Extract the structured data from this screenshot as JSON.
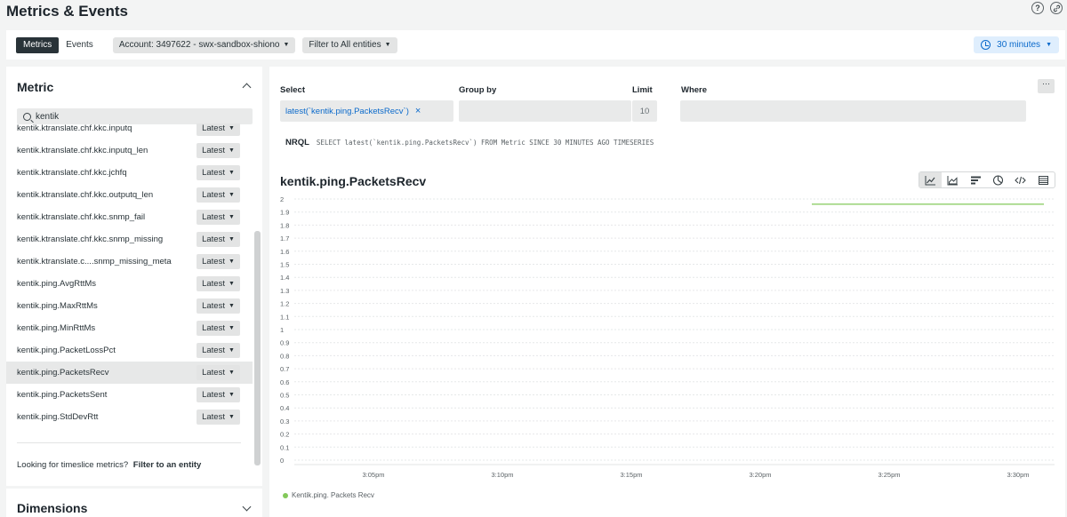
{
  "page": {
    "title": "Metrics & Events",
    "help_icon": "question-circle-icon",
    "link_icon": "link-icon"
  },
  "toolbar": {
    "tabs": [
      {
        "label": "Metrics",
        "active": true
      },
      {
        "label": "Events",
        "active": false
      }
    ],
    "account_label": "Account: 3497622 - swx-sandbox-shiono",
    "filter_label": "Filter to All entities",
    "time_label": "30 minutes"
  },
  "left_panel": {
    "title": "Metric",
    "search_value": "kentik",
    "metrics": [
      {
        "name": "kentik.ktranslate.chf.kkc.inputq",
        "agg": "Latest"
      },
      {
        "name": "kentik.ktranslate.chf.kkc.inputq_len",
        "agg": "Latest"
      },
      {
        "name": "kentik.ktranslate.chf.kkc.jchfq",
        "agg": "Latest"
      },
      {
        "name": "kentik.ktranslate.chf.kkc.outputq_len",
        "agg": "Latest"
      },
      {
        "name": "kentik.ktranslate.chf.kkc.snmp_fail",
        "agg": "Latest"
      },
      {
        "name": "kentik.ktranslate.chf.kkc.snmp_missing",
        "agg": "Latest"
      },
      {
        "name": "kentik.ktranslate.c....snmp_missing_meta",
        "agg": "Latest"
      },
      {
        "name": "kentik.ping.AvgRttMs",
        "agg": "Latest"
      },
      {
        "name": "kentik.ping.MaxRttMs",
        "agg": "Latest"
      },
      {
        "name": "kentik.ping.MinRttMs",
        "agg": "Latest"
      },
      {
        "name": "kentik.ping.PacketLossPct",
        "agg": "Latest"
      },
      {
        "name": "kentik.ping.PacketsRecv",
        "agg": "Latest",
        "selected": true
      },
      {
        "name": "kentik.ping.PacketsSent",
        "agg": "Latest"
      },
      {
        "name": "kentik.ping.StdDevRtt",
        "agg": "Latest"
      }
    ],
    "timeslice_text": "Looking for timeslice metrics?",
    "timeslice_link": "Filter to an entity",
    "dimensions_title": "Dimensions"
  },
  "query": {
    "select_label": "Select",
    "select_value": "latest(`kentik.ping.PacketsRecv`)",
    "groupby_label": "Group by",
    "limit_label": "Limit",
    "limit_placeholder": "10",
    "where_label": "Where",
    "more_label": "···",
    "nrql_tag": "NRQL",
    "nrql_query": "SELECT latest(`kentik.ping.PacketsRecv`) FROM Metric SINCE 30 MINUTES AGO TIMESERIES"
  },
  "chart_types": [
    "line-chart-icon",
    "area-chart-icon",
    "bar-chart-icon",
    "pie-chart-icon",
    "code-icon",
    "table-icon"
  ],
  "chart_data": {
    "type": "line",
    "title": "kentik.ping.PacketsRecv",
    "xlabel": "",
    "ylabel": "",
    "ylim": [
      0,
      2
    ],
    "y_ticks": [
      "2",
      "1.9",
      "1.8",
      "1.7",
      "1.6",
      "1.5",
      "1.4",
      "1.3",
      "1.2",
      "1.1",
      "1",
      "0.9",
      "0.8",
      "0.7",
      "0.6",
      "0.5",
      "0.4",
      "0.3",
      "0.2",
      "0.1",
      "0"
    ],
    "x_ticks": [
      "3:05pm",
      "3:10pm",
      "3:15pm",
      "3:20pm",
      "3:25pm",
      "3:30pm"
    ],
    "grid": true,
    "legend": "bottom-left",
    "series": [
      {
        "name": "Kentik.ping. Packets Recv",
        "color": "#83c85a",
        "x": [
          "3:22pm",
          "3:23pm",
          "3:24pm",
          "3:25pm",
          "3:26pm",
          "3:27pm",
          "3:28pm",
          "3:29pm",
          "3:30pm",
          "3:31pm"
        ],
        "values": [
          1.96,
          1.96,
          1.96,
          1.96,
          1.96,
          1.96,
          1.96,
          1.96,
          1.96,
          1.96
        ]
      }
    ]
  }
}
